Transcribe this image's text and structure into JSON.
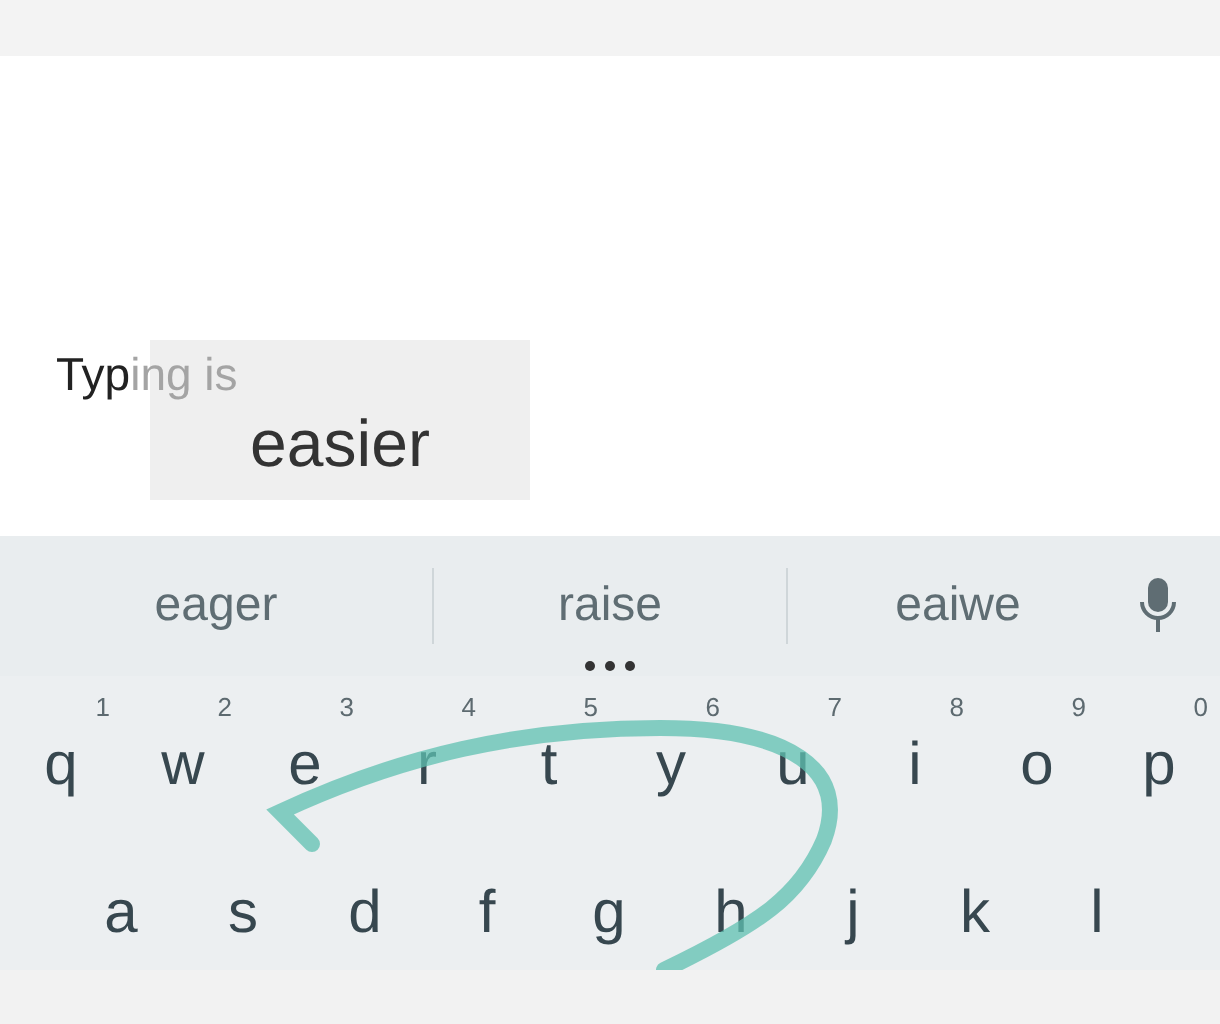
{
  "input": {
    "typed": "Typ",
    "preview": "ing is"
  },
  "popup": {
    "word": "easier"
  },
  "suggestions": [
    "eager",
    "raise",
    "eaiwe"
  ],
  "rows": [
    [
      {
        "letter": "q",
        "hint": "1"
      },
      {
        "letter": "w",
        "hint": "2"
      },
      {
        "letter": "e",
        "hint": "3"
      },
      {
        "letter": "r",
        "hint": "4"
      },
      {
        "letter": "t",
        "hint": "5"
      },
      {
        "letter": "y",
        "hint": "6"
      },
      {
        "letter": "u",
        "hint": "7"
      },
      {
        "letter": "i",
        "hint": "8"
      },
      {
        "letter": "o",
        "hint": "9"
      },
      {
        "letter": "p",
        "hint": "0"
      }
    ],
    [
      {
        "letter": "a"
      },
      {
        "letter": "s"
      },
      {
        "letter": "d"
      },
      {
        "letter": "f"
      },
      {
        "letter": "g"
      },
      {
        "letter": "h"
      },
      {
        "letter": "j"
      },
      {
        "letter": "k"
      },
      {
        "letter": "l"
      }
    ]
  ]
}
